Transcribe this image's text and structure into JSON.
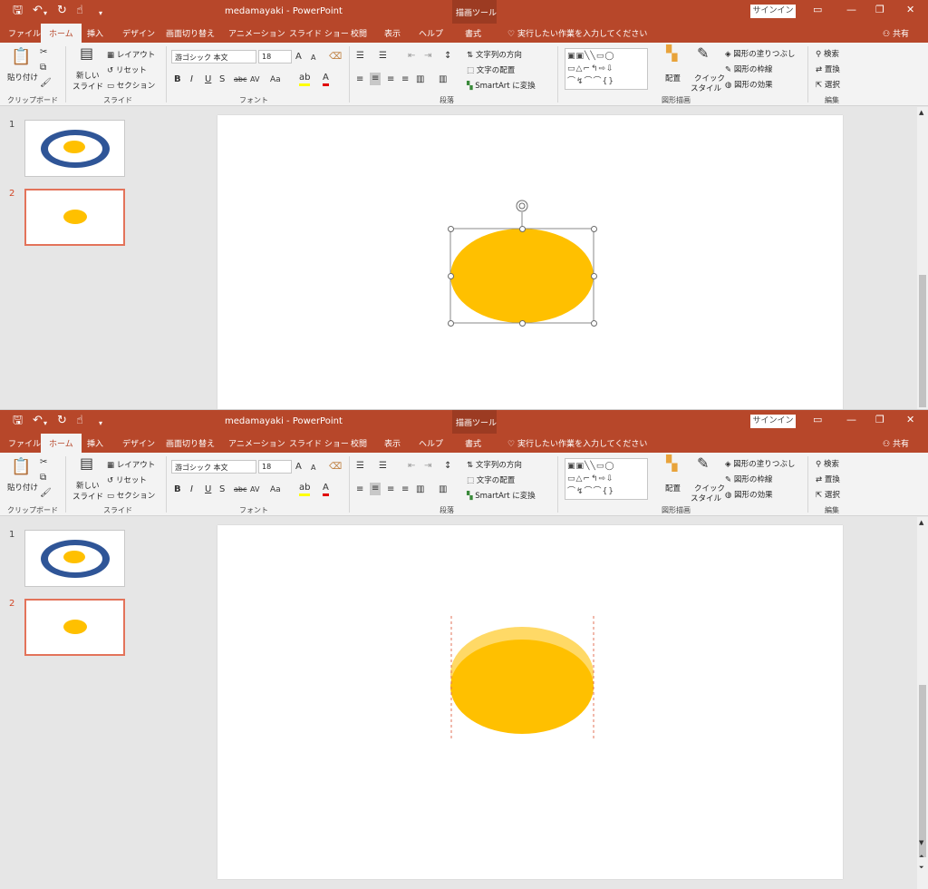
{
  "app": {
    "doc_title": "medamayaki  -  PowerPoint",
    "context_tool_label": "描画ツール",
    "signin": "サインイン",
    "tell_me": "実行したい作業を入力してください",
    "share": "共有"
  },
  "tabs": [
    "ファイル",
    "ホーム",
    "挿入",
    "デザイン",
    "画面切り替え",
    "アニメーション",
    "スライド ショー",
    "校閲",
    "表示",
    "ヘルプ",
    "書式"
  ],
  "ribbon": {
    "clipboard": {
      "paste": "貼り付け",
      "group": "クリップボード"
    },
    "slides": {
      "new_slide_1": "新しい",
      "new_slide_2": "スライド",
      "layout": "レイアウト",
      "reset": "リセット",
      "section": "セクション",
      "group": "スライド"
    },
    "font": {
      "font_name": "游ゴシック 本文",
      "font_size": "18",
      "group": "フォント"
    },
    "paragraph": {
      "text_direction": "文字列の方向",
      "align_text": "文字の配置",
      "smartart": "SmartArt に変換",
      "group": "段落"
    },
    "drawing": {
      "arrange": "配置",
      "quick_styles_1": "クイック",
      "quick_styles_2": "スタイル",
      "shape_fill": "図形の塗りつぶし",
      "shape_outline": "図形の枠線",
      "shape_effects": "図形の効果",
      "group": "図形描画"
    },
    "editing": {
      "find": "検索",
      "replace": "置換",
      "select": "選択",
      "group": "編集"
    }
  },
  "slides": [
    {
      "number": "1"
    },
    {
      "number": "2"
    }
  ],
  "colors": {
    "accent": "#b7472a",
    "yolk": "#ffc000",
    "yolk_light": "#ffd966",
    "egg_blue": "#2f5597",
    "selected_thumb_border": "#e3735a"
  }
}
